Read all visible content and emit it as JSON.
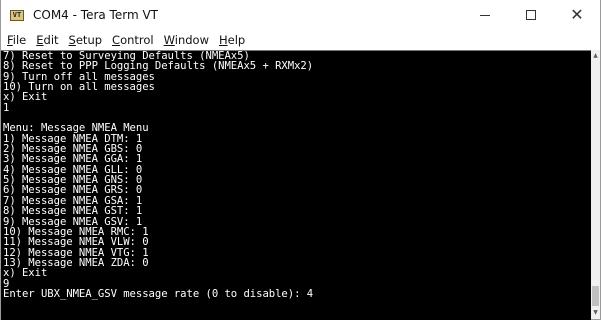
{
  "window": {
    "title": "COM4 - Tera Term VT",
    "icon_text": "VT"
  },
  "menu": {
    "items": [
      {
        "label": "File",
        "key": "F",
        "rest": "ile"
      },
      {
        "label": "Edit",
        "key": "E",
        "rest": "dit"
      },
      {
        "label": "Setup",
        "key": "S",
        "rest": "etup"
      },
      {
        "label": "Control",
        "key": "C",
        "rest": "ontrol"
      },
      {
        "label": "Window",
        "key": "W",
        "rest": "indow"
      },
      {
        "label": "Help",
        "key": "H",
        "rest": "elp"
      }
    ]
  },
  "terminal": {
    "lines": [
      "7) Reset to Surveying Defaults (NMEAx5)",
      "8) Reset to PPP Logging Defaults (NMEAx5 + RXMx2)",
      "9) Turn off all messages",
      "10) Turn on all messages",
      "x) Exit",
      "1",
      "",
      "Menu: Message NMEA Menu",
      "1) Message NMEA DTM: 1",
      "2) Message NMEA GBS: 0",
      "3) Message NMEA GGA: 1",
      "4) Message NMEA GLL: 0",
      "5) Message NMEA GNS: 0",
      "6) Message NMEA GRS: 0",
      "7) Message NMEA GSA: 1",
      "8) Message NMEA GST: 1",
      "9) Message NMEA GSV: 1",
      "10) Message NMEA RMC: 1",
      "11) Message NMEA VLW: 0",
      "12) Message NMEA VTG: 1",
      "13) Message NMEA ZDA: 0",
      "x) Exit",
      "9",
      "Enter UBX_NMEA_GSV message rate (0 to disable): 4"
    ]
  },
  "controls": {
    "minimize": "–",
    "maximize": "□",
    "close": "✕",
    "scroll_up": "▲",
    "scroll_down": "▼"
  }
}
